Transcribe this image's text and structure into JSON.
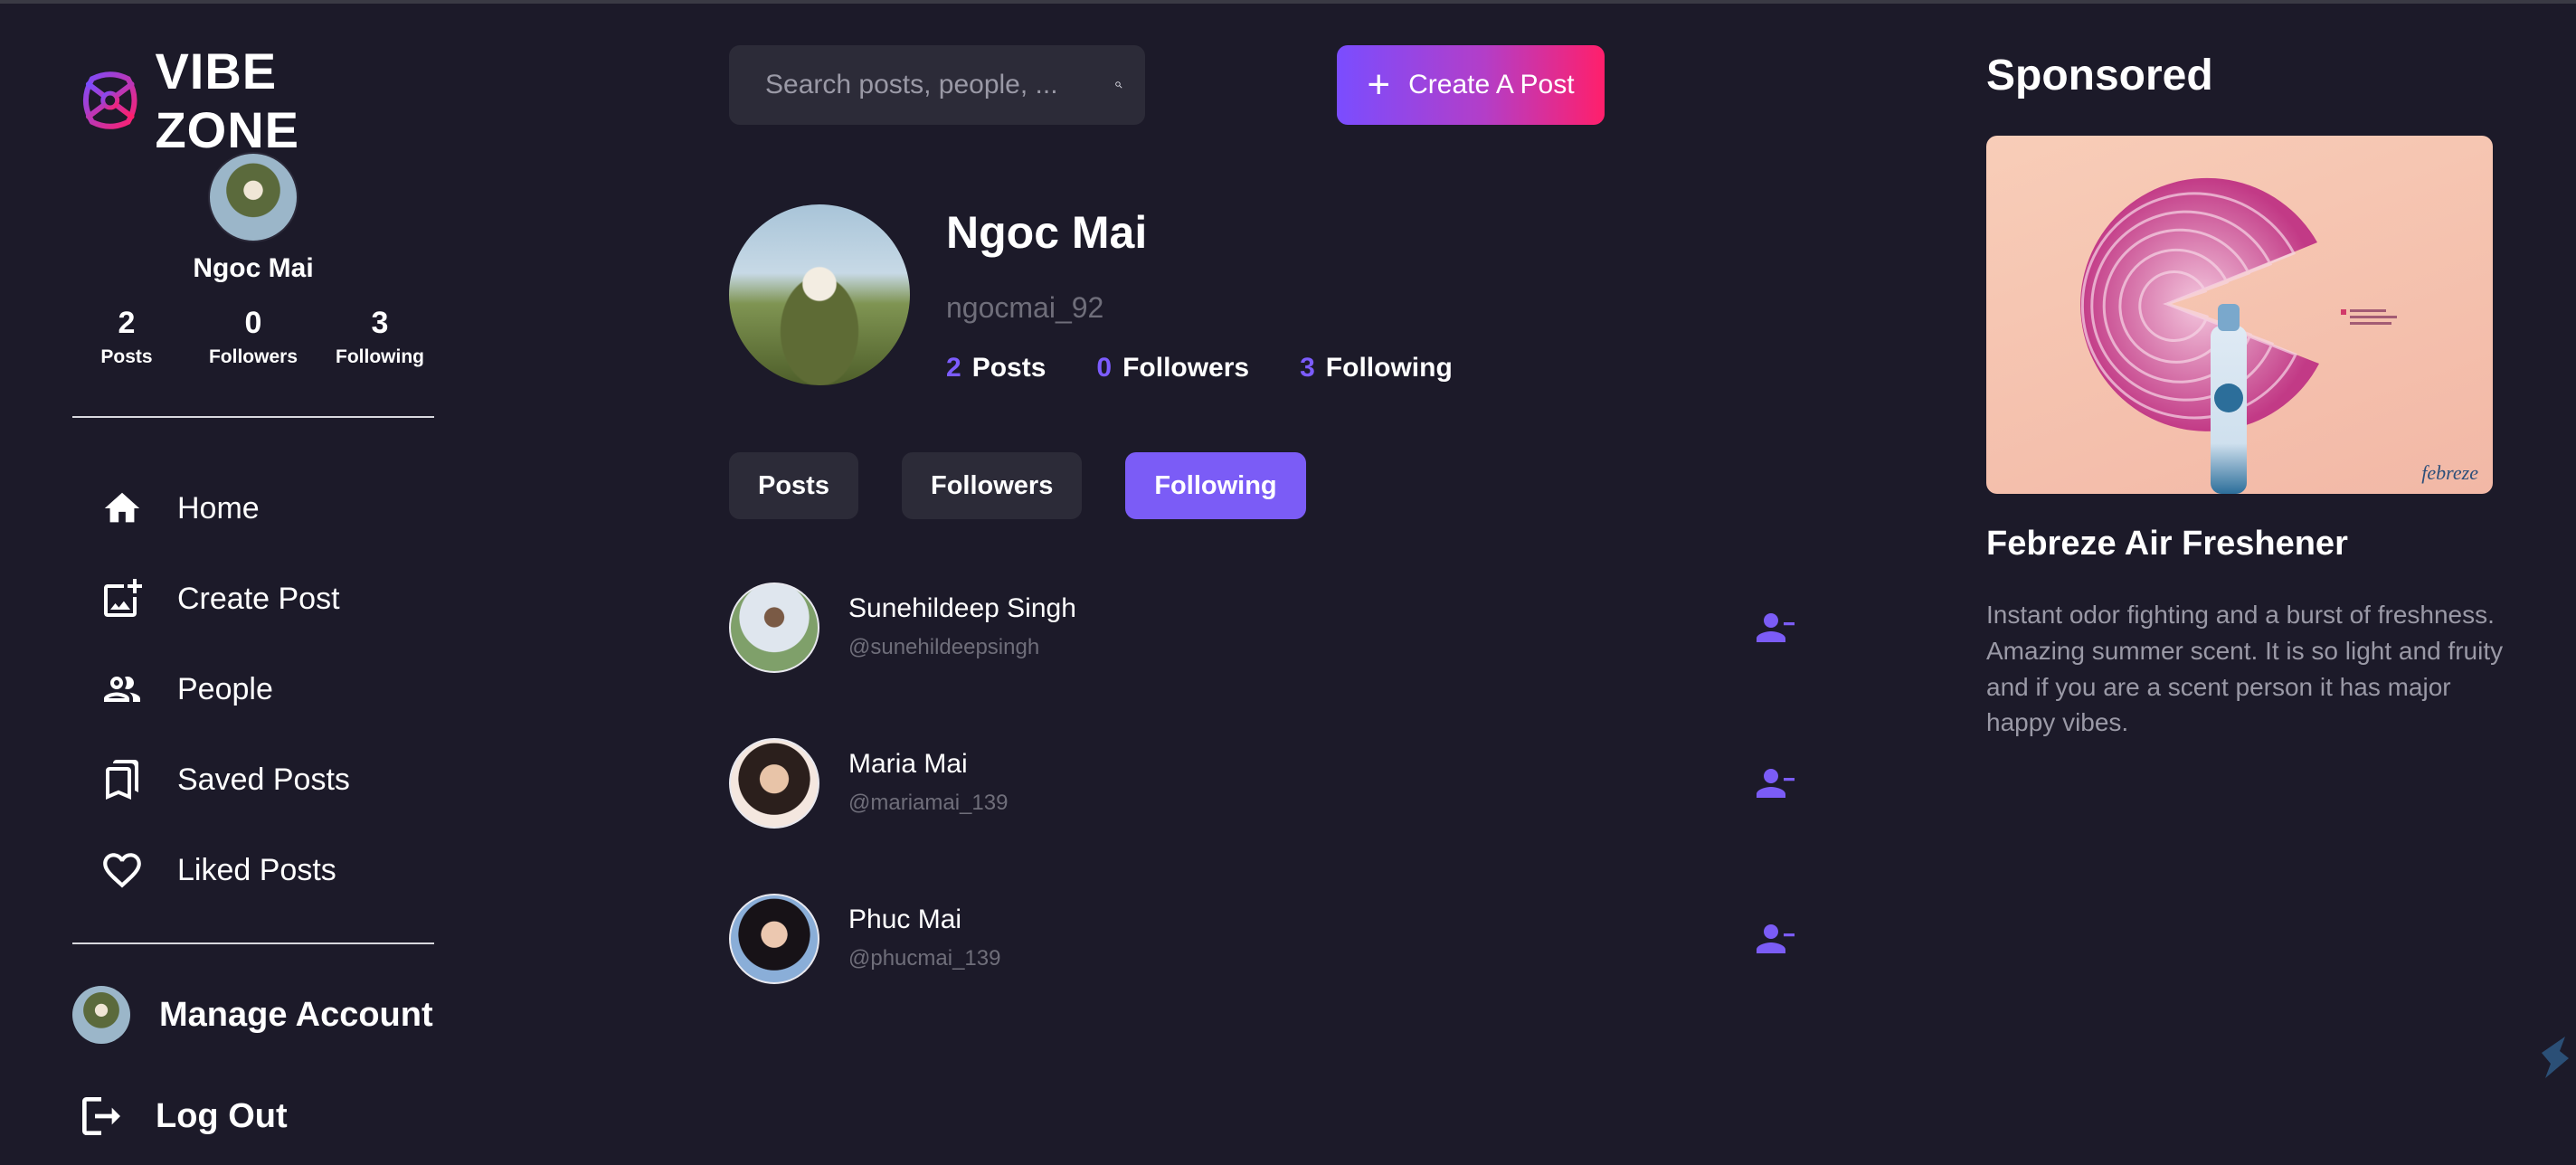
{
  "app": {
    "name": "VIBE ZONE"
  },
  "sidebar": {
    "profile": {
      "name": "Ngoc Mai",
      "stats": [
        {
          "value": "2",
          "label": "Posts"
        },
        {
          "value": "0",
          "label": "Followers"
        },
        {
          "value": "3",
          "label": "Following"
        }
      ]
    },
    "nav": [
      {
        "label": "Home",
        "icon": "home-icon"
      },
      {
        "label": "Create Post",
        "icon": "add-photo-icon"
      },
      {
        "label": "People",
        "icon": "people-icon"
      },
      {
        "label": "Saved Posts",
        "icon": "bookmark-icon"
      },
      {
        "label": "Liked Posts",
        "icon": "heart-icon"
      }
    ],
    "manage_account": "Manage Account",
    "logout": "Log Out"
  },
  "header": {
    "search_placeholder": "Search posts, people, ...",
    "create_label": "Create A Post"
  },
  "profile": {
    "name": "Ngoc Mai",
    "handle": "ngocmai_92",
    "stats": [
      {
        "value": "2",
        "label": "Posts"
      },
      {
        "value": "0",
        "label": "Followers"
      },
      {
        "value": "3",
        "label": "Following"
      }
    ],
    "tabs": [
      {
        "label": "Posts",
        "active": false
      },
      {
        "label": "Followers",
        "active": false
      },
      {
        "label": "Following",
        "active": true
      }
    ],
    "following": [
      {
        "name": "Sunehildeep Singh",
        "handle": "@sunehildeepsingh"
      },
      {
        "name": "Maria Mai",
        "handle": "@mariamai_139"
      },
      {
        "name": "Phuc Mai",
        "handle": "@phucmai_139"
      }
    ]
  },
  "sponsored": {
    "title": "Sponsored",
    "ad_title": "Febreze Air Freshener",
    "ad_description": "Instant odor fighting and a burst of freshness. Amazing summer scent. It is so light and fruity and if you are a scent person it has major happy vibes.",
    "ad_brand_mark": "febreze"
  },
  "colors": {
    "background": "#1c1a29",
    "accent": "#7b5cf6",
    "gradient_start": "#7a4dff",
    "gradient_end": "#ff1f6b",
    "muted_text": "#6f6e7a"
  }
}
